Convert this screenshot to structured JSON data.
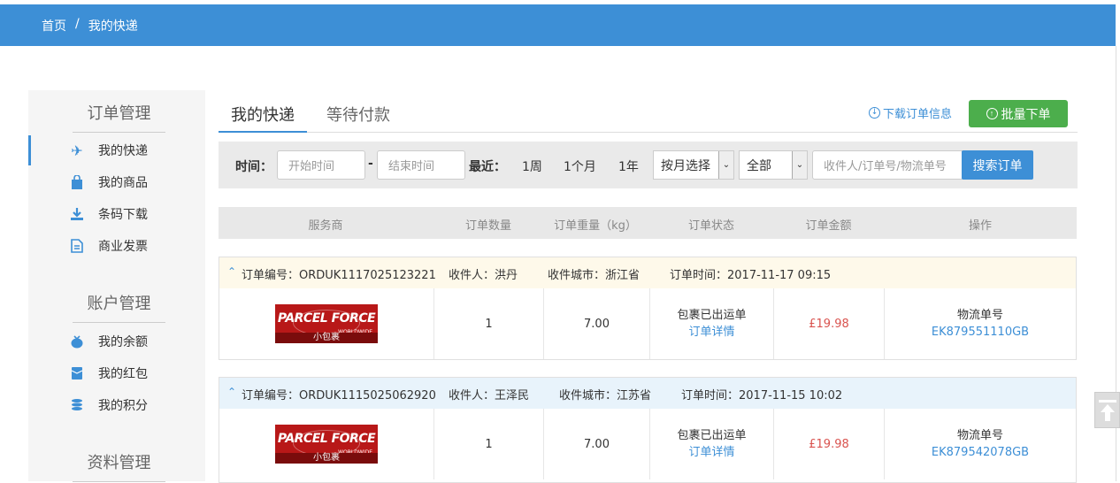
{
  "breadcrumb": {
    "home": "首页",
    "sep": "/",
    "current": "我的快递"
  },
  "sidebar": {
    "sections": [
      {
        "title": "订单管理"
      },
      {
        "title": "账户管理"
      },
      {
        "title": "资料管理"
      }
    ],
    "items": [
      {
        "label": "我的快递",
        "icon": "airplane-icon"
      },
      {
        "label": "我的商品",
        "icon": "shopping-bag-icon"
      },
      {
        "label": "条码下载",
        "icon": "download-icon"
      },
      {
        "label": "商业发票",
        "icon": "document-icon"
      },
      {
        "label": "我的余额",
        "icon": "money-bag-icon"
      },
      {
        "label": "我的红包",
        "icon": "red-envelope-icon"
      },
      {
        "label": "我的积分",
        "icon": "coins-icon"
      }
    ]
  },
  "tabs": [
    {
      "label": "我的快递"
    },
    {
      "label": "等待付款"
    }
  ],
  "actions": {
    "download": "下载订单信息",
    "batch": "批量下单"
  },
  "filter": {
    "time_label": "时间：",
    "start_placeholder": "开始时间",
    "dash": "-",
    "end_placeholder": "结束时间",
    "recent_label": "最近：",
    "ranges": [
      "1周",
      "1个月",
      "1年"
    ],
    "month_select": "按月选择",
    "status_select": "全部",
    "search_placeholder": "收件人/订单号/物流单号",
    "search_button": "搜索订单"
  },
  "table": {
    "headers": [
      "服务商",
      "订单数量",
      "订单重量（kg）",
      "订单状态",
      "订单金额",
      "操作"
    ]
  },
  "orders": [
    {
      "order_no": "订单编号：ORDUK1117025123221",
      "recipient": "收件人：洪丹",
      "city": "收件城市：浙江省",
      "time": "订单时间：2017-11-17 09:15",
      "carrier_logo": "PARCEL FORCE",
      "carrier_sub": "WORLDWIDE",
      "carrier_tag": "小包裹",
      "quantity": "1",
      "weight": "7.00",
      "status": "包裹已出运单",
      "detail_link": "订单详情",
      "amount": "£19.98",
      "tracking_label": "物流单号",
      "tracking_no": "EK879551110GB",
      "header_bg": "#fef9ea"
    },
    {
      "order_no": "订单编号：ORDUK1115025062920",
      "recipient": "收件人：王泽民",
      "city": "收件城市：江苏省",
      "time": "订单时间：2017-11-15 10:02",
      "carrier_logo": "PARCEL FORCE",
      "carrier_sub": "WORLDWIDE",
      "carrier_tag": "小包裹",
      "quantity": "1",
      "weight": "7.00",
      "status": "包裹已出运单",
      "detail_link": "订单详情",
      "amount": "£19.98",
      "tracking_label": "物流单号",
      "tracking_no": "EK879542078GB",
      "header_bg": "#e8f3fb"
    }
  ],
  "colors": {
    "primary": "#3d8fd6",
    "success": "#4cae4c",
    "price": "#d9534f"
  }
}
